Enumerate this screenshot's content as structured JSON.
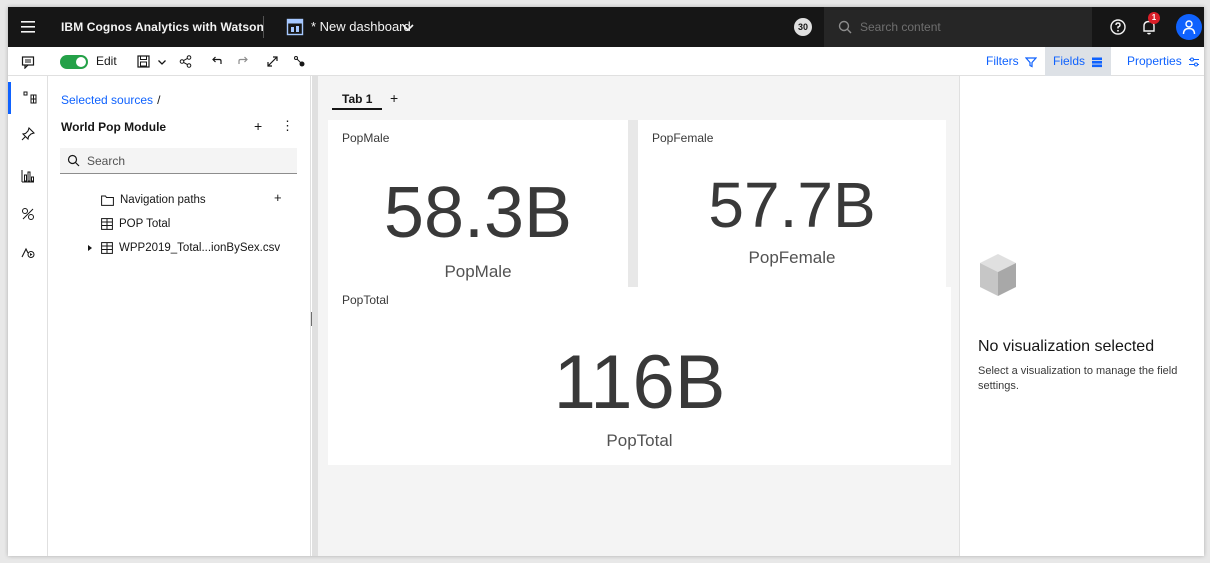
{
  "app": {
    "title": "IBM Cognos Analytics with Watson",
    "dashboard_title": "* New dashboard",
    "badge_count": "30",
    "search_placeholder": "Search content",
    "notification_count": "1"
  },
  "toolbar": {
    "edit_label": "Edit",
    "filters_label": "Filters",
    "fields_label": "Fields",
    "properties_label": "Properties"
  },
  "rail_icons": [
    "data-sources-icon",
    "pin-icon",
    "visualizations-icon",
    "assistant-icon",
    "navigation-icon"
  ],
  "data_panel": {
    "breadcrumb": "Selected sources",
    "breadcrumb_sep": "/",
    "module_name": "World Pop Module",
    "add_label": "+",
    "more_label": "⋮",
    "search_placeholder": "Search",
    "tree": [
      {
        "label": "Navigation paths",
        "icon": "folder-icon"
      },
      {
        "label": "POP Total",
        "icon": "table-icon"
      },
      {
        "label": "WPP2019_Total...ionBySex.csv",
        "icon": "table-icon",
        "expandable": true
      }
    ]
  },
  "tabs": [
    {
      "label": "Tab 1",
      "active": true
    }
  ],
  "tab_add_label": "+",
  "widgets": [
    {
      "title": "PopMale",
      "value": "58.3B",
      "label": "PopMale"
    },
    {
      "title": "PopFemale",
      "value": "57.7B",
      "label": "PopFemale"
    },
    {
      "title": "PopTotal",
      "value": "116B",
      "label": "PopTotal"
    }
  ],
  "right_panel": {
    "title": "No visualization selected",
    "text": "Select a visualization to manage the field settings."
  },
  "colors": {
    "topbar": "#161616",
    "accent": "#0f62fe",
    "toggle_on": "#24a148",
    "notification": "#da1e28"
  }
}
